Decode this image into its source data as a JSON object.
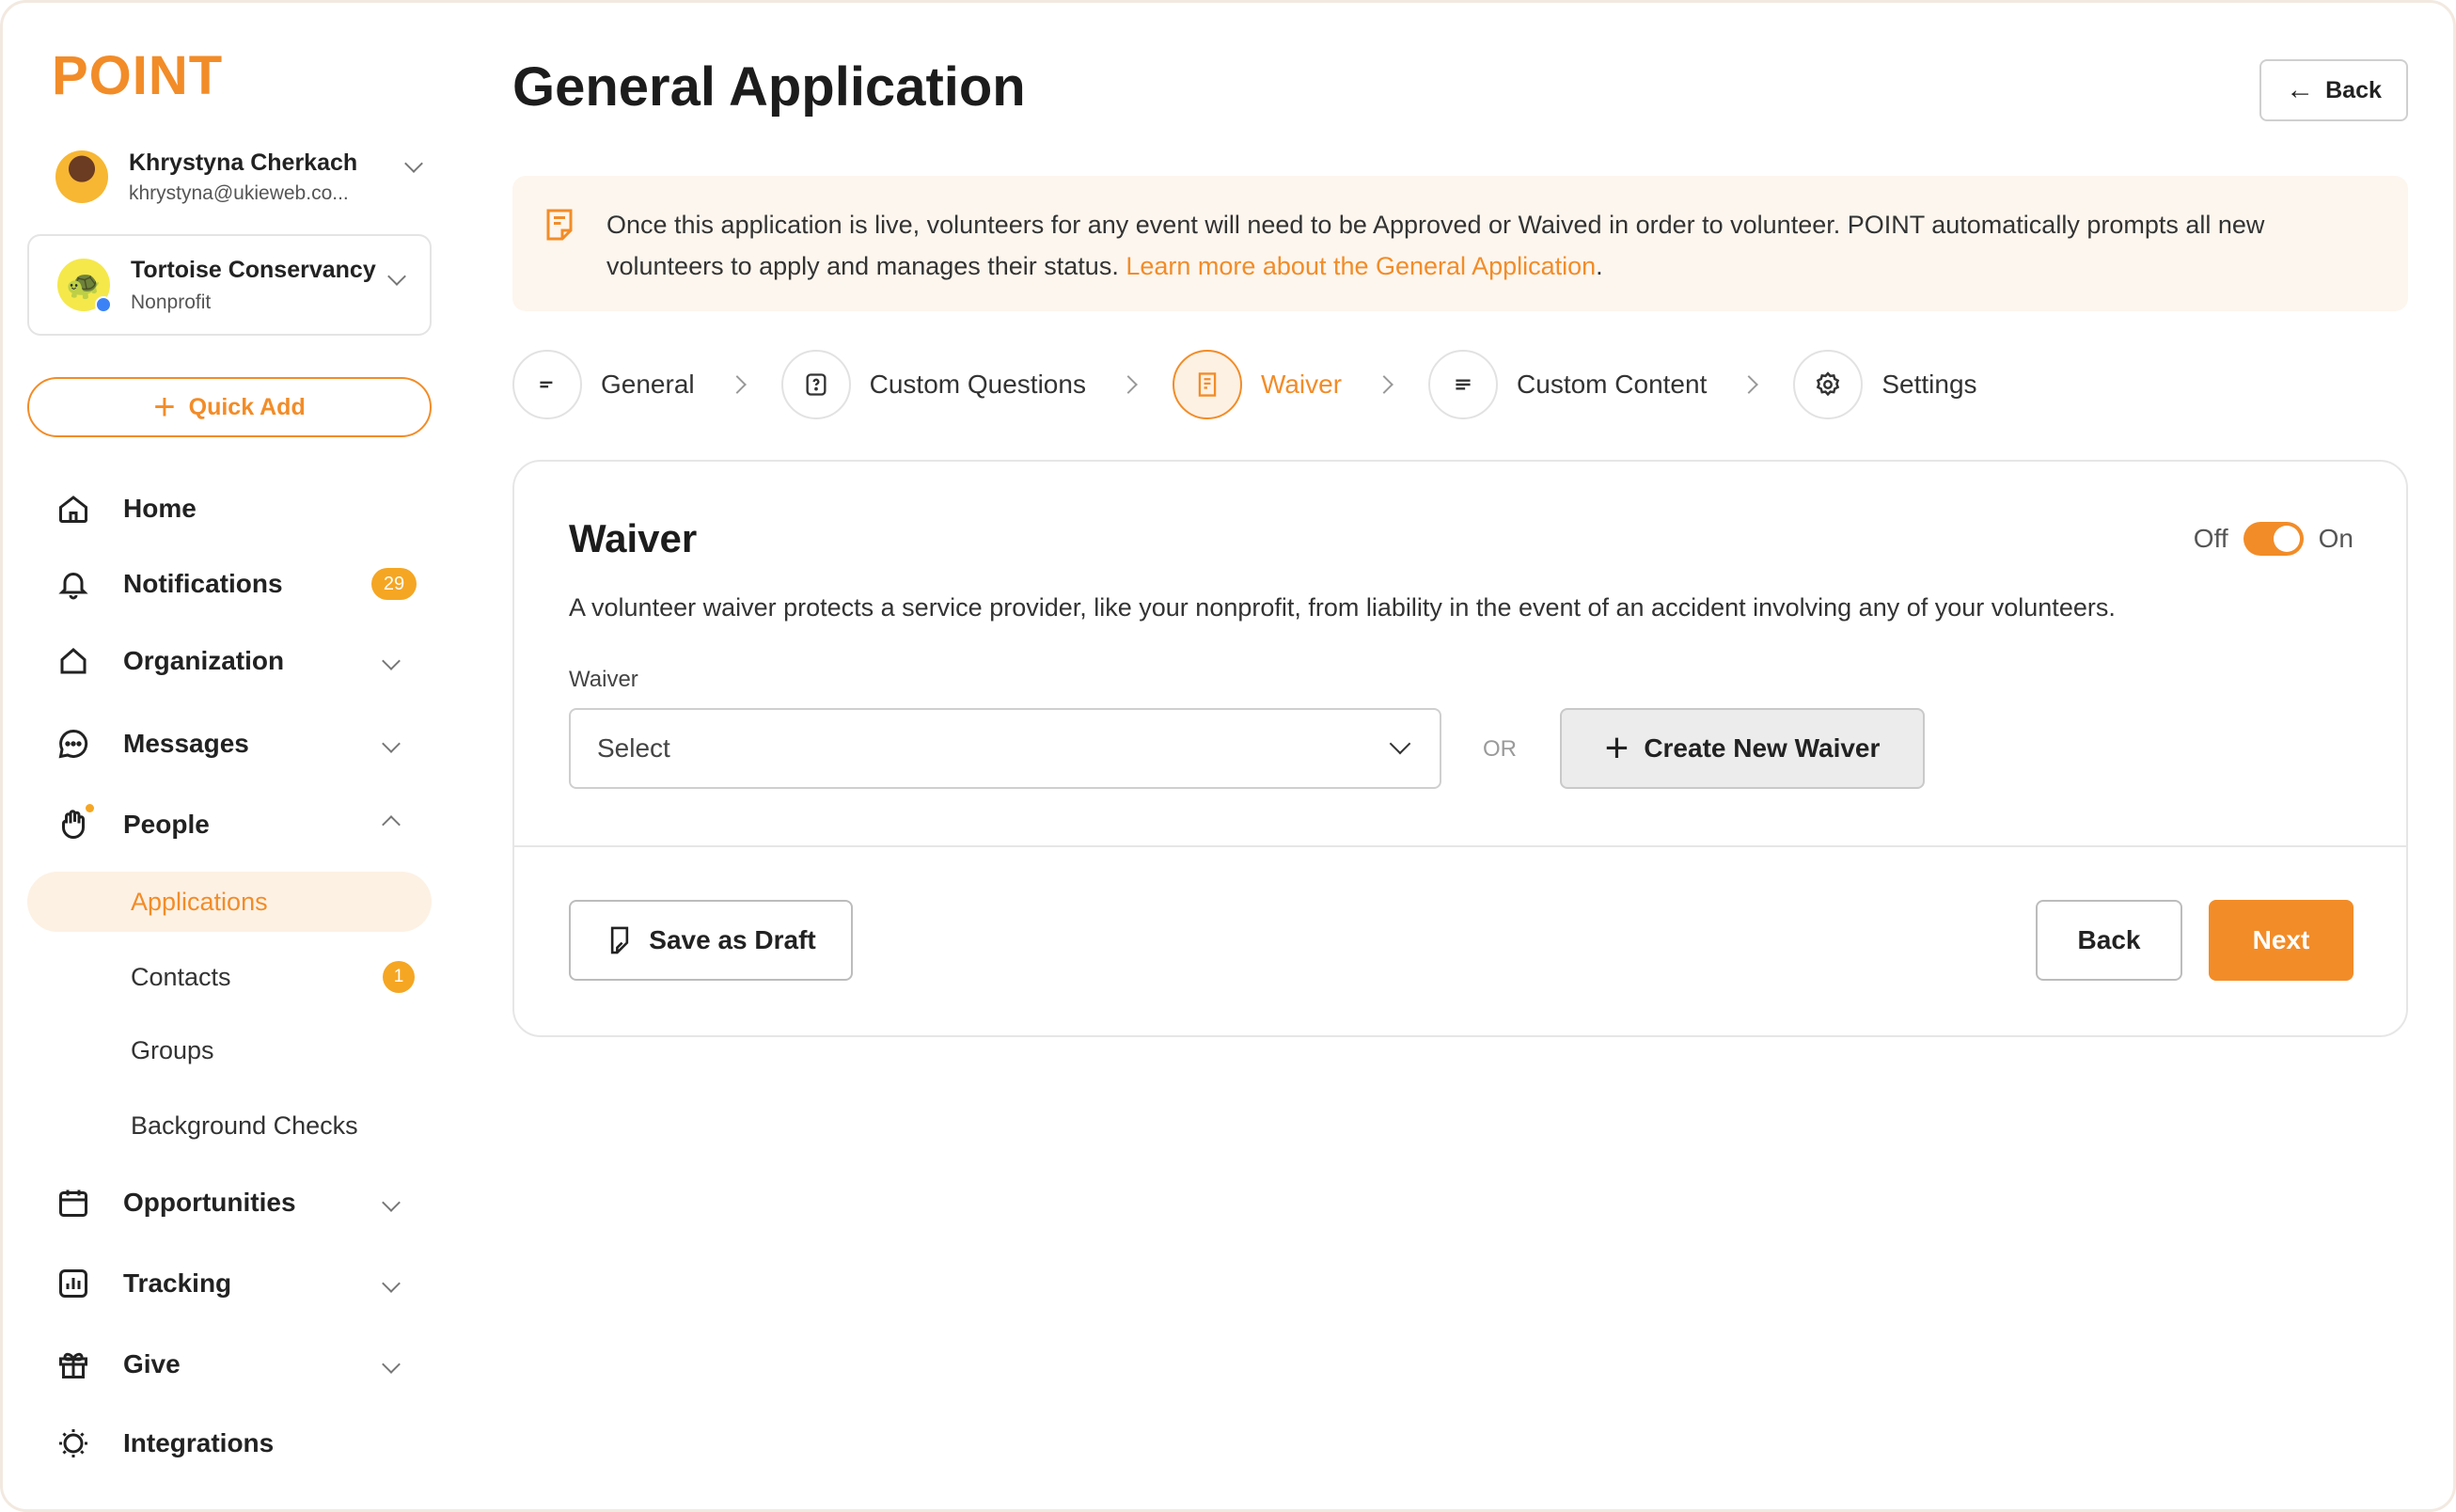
{
  "brand": {
    "logo": "POINT",
    "accent": "#f28c28"
  },
  "user": {
    "name": "Khrystyna Cherkach",
    "email": "khrystyna@ukieweb.co..."
  },
  "org": {
    "name": "Tortoise Conservancy",
    "type": "Nonprofit"
  },
  "quick_add": "Quick Add",
  "nav": {
    "home": "Home",
    "notifications": "Notifications",
    "notifications_badge": "29",
    "organization": "Organization",
    "messages": "Messages",
    "people": "People",
    "people_sub": {
      "applications": "Applications",
      "contacts": "Contacts",
      "contacts_badge": "1",
      "groups": "Groups",
      "background_checks": "Background Checks"
    },
    "opportunities": "Opportunities",
    "tracking": "Tracking",
    "give": "Give",
    "integrations": "Integrations"
  },
  "header": {
    "title": "General Application",
    "back": "Back"
  },
  "banner": {
    "text": "Once this application is live, volunteers for any event will need to be Approved or Waived in order to volunteer. POINT automatically prompts all new volunteers to apply and manages their status. ",
    "link": "Learn more about the General Application",
    "suffix": "."
  },
  "steps": [
    {
      "label": "General",
      "icon": "lines-icon"
    },
    {
      "label": "Custom Questions",
      "icon": "question-icon"
    },
    {
      "label": "Waiver",
      "icon": "document-icon",
      "active": true
    },
    {
      "label": "Custom Content",
      "icon": "lines-icon"
    },
    {
      "label": "Settings",
      "icon": "gear-icon"
    }
  ],
  "waiver": {
    "title": "Waiver",
    "toggle_off": "Off",
    "toggle_on": "On",
    "toggle_state": "on",
    "description": "A volunteer waiver protects a service provider, like your nonprofit, from liability in the event of an accident involving any of your volunteers.",
    "field_label": "Waiver",
    "select_placeholder": "Select",
    "or": "OR",
    "create_button": "Create New Waiver",
    "save_draft": "Save as Draft",
    "back": "Back",
    "next": "Next"
  }
}
